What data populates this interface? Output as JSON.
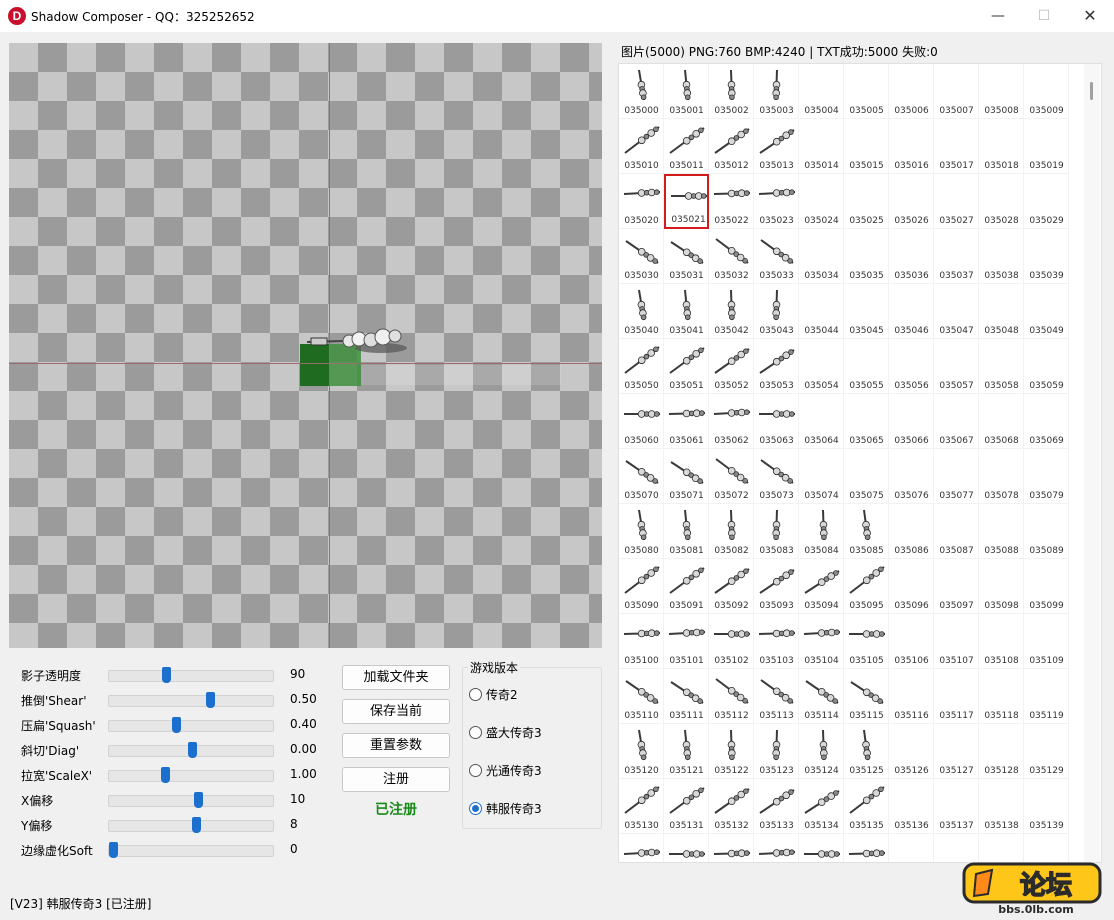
{
  "window": {
    "title": "Shadow Composer - QQ：325252652",
    "icon_letter": "D",
    "min": "—",
    "max": "☐",
    "close": "✕"
  },
  "sliders": [
    {
      "label": "影子透明度",
      "value": "90",
      "fraction": 0.34
    },
    {
      "label": "推倒'Shear'",
      "value": "0.50",
      "fraction": 0.62
    },
    {
      "label": "压扁'Squash'",
      "value": "0.40",
      "fraction": 0.4
    },
    {
      "label": "斜切'Diag'",
      "value": "0.00",
      "fraction": 0.5
    },
    {
      "label": "拉宽'ScaleX'",
      "value": "1.00",
      "fraction": 0.33
    },
    {
      "label": "X偏移",
      "value": "10",
      "fraction": 0.54
    },
    {
      "label": "Y偏移",
      "value": "8",
      "fraction": 0.53
    },
    {
      "label": "边缘虚化Soft",
      "value": "0",
      "fraction": 0.0
    }
  ],
  "buttons": {
    "load_folder": "加载文件夹",
    "save_current": "保存当前",
    "reset_params": "重置参数",
    "register": "注册",
    "registered": "已注册"
  },
  "game_version": {
    "title": "游戏版本",
    "options": [
      "传奇2",
      "盛大传奇3",
      "光通传奇3",
      "韩服传奇3"
    ],
    "selected_index": 3
  },
  "status_bar": "[V23] 韩服传奇3 [已注册]",
  "image_panel": {
    "header": "图片(5000) PNG:760 BMP:4240 | TXT成功:5000 失败:0",
    "columns": 10,
    "selected": "035021",
    "rows": [
      {
        "labels": [
          "035000",
          "035001",
          "035002",
          "035003",
          "035004",
          "035005",
          "035006",
          "035007",
          "035008",
          "035009"
        ],
        "sprites": 4,
        "kind": "vertical"
      },
      {
        "labels": [
          "035010",
          "035011",
          "035012",
          "035013",
          "035014",
          "035015",
          "035016",
          "035017",
          "035018",
          "035019"
        ],
        "sprites": 4,
        "kind": "diag"
      },
      {
        "labels": [
          "035020",
          "035021",
          "035022",
          "035023",
          "035024",
          "035025",
          "035026",
          "035027",
          "035028",
          "035029"
        ],
        "sprites": 4,
        "kind": "horizontal"
      },
      {
        "labels": [
          "035030",
          "035031",
          "035032",
          "035033",
          "035034",
          "035035",
          "035036",
          "035037",
          "035038",
          "035039"
        ],
        "sprites": 4,
        "kind": "diagdown"
      },
      {
        "labels": [
          "035040",
          "035041",
          "035042",
          "035043",
          "035044",
          "035045",
          "035046",
          "035047",
          "035048",
          "035049"
        ],
        "sprites": 4,
        "kind": "vertical"
      },
      {
        "labels": [
          "035050",
          "035051",
          "035052",
          "035053",
          "035054",
          "035055",
          "035056",
          "035057",
          "035058",
          "035059"
        ],
        "sprites": 4,
        "kind": "diag"
      },
      {
        "labels": [
          "035060",
          "035061",
          "035062",
          "035063",
          "035064",
          "035065",
          "035066",
          "035067",
          "035068",
          "035069"
        ],
        "sprites": 4,
        "kind": "horizontal"
      },
      {
        "labels": [
          "035070",
          "035071",
          "035072",
          "035073",
          "035074",
          "035075",
          "035076",
          "035077",
          "035078",
          "035079"
        ],
        "sprites": 4,
        "kind": "diagdown"
      },
      {
        "labels": [
          "035080",
          "035081",
          "035082",
          "035083",
          "035084",
          "035085",
          "035086",
          "035087",
          "035088",
          "035089"
        ],
        "sprites": 6,
        "kind": "vertical"
      },
      {
        "labels": [
          "035090",
          "035091",
          "035092",
          "035093",
          "035094",
          "035095",
          "035096",
          "035097",
          "035098",
          "035099"
        ],
        "sprites": 6,
        "kind": "diag"
      },
      {
        "labels": [
          "035100",
          "035101",
          "035102",
          "035103",
          "035104",
          "035105",
          "035106",
          "035107",
          "035108",
          "035109"
        ],
        "sprites": 6,
        "kind": "horizontal"
      },
      {
        "labels": [
          "035110",
          "035111",
          "035112",
          "035113",
          "035114",
          "035115",
          "035116",
          "035117",
          "035118",
          "035119"
        ],
        "sprites": 6,
        "kind": "diagdown"
      },
      {
        "labels": [
          "035120",
          "035121",
          "035122",
          "035123",
          "035124",
          "035125",
          "035126",
          "035127",
          "035128",
          "035129"
        ],
        "sprites": 6,
        "kind": "vertical"
      },
      {
        "labels": [
          "035130",
          "035131",
          "035132",
          "035133",
          "035134",
          "035135",
          "035136",
          "035137",
          "035138",
          "035139"
        ],
        "sprites": 6,
        "kind": "diag"
      },
      {
        "labels": [
          "",
          "",
          "",
          "",
          "",
          "",
          "",
          "",
          "",
          ""
        ],
        "sprites": 6,
        "kind": "horizontal"
      }
    ]
  },
  "watermark": {
    "text": "论坛",
    "url": "bbs.0lb.com"
  },
  "colors": {
    "accent": "#1d6fce",
    "registered": "#1a8a1a",
    "selection": "#d21b1b"
  }
}
